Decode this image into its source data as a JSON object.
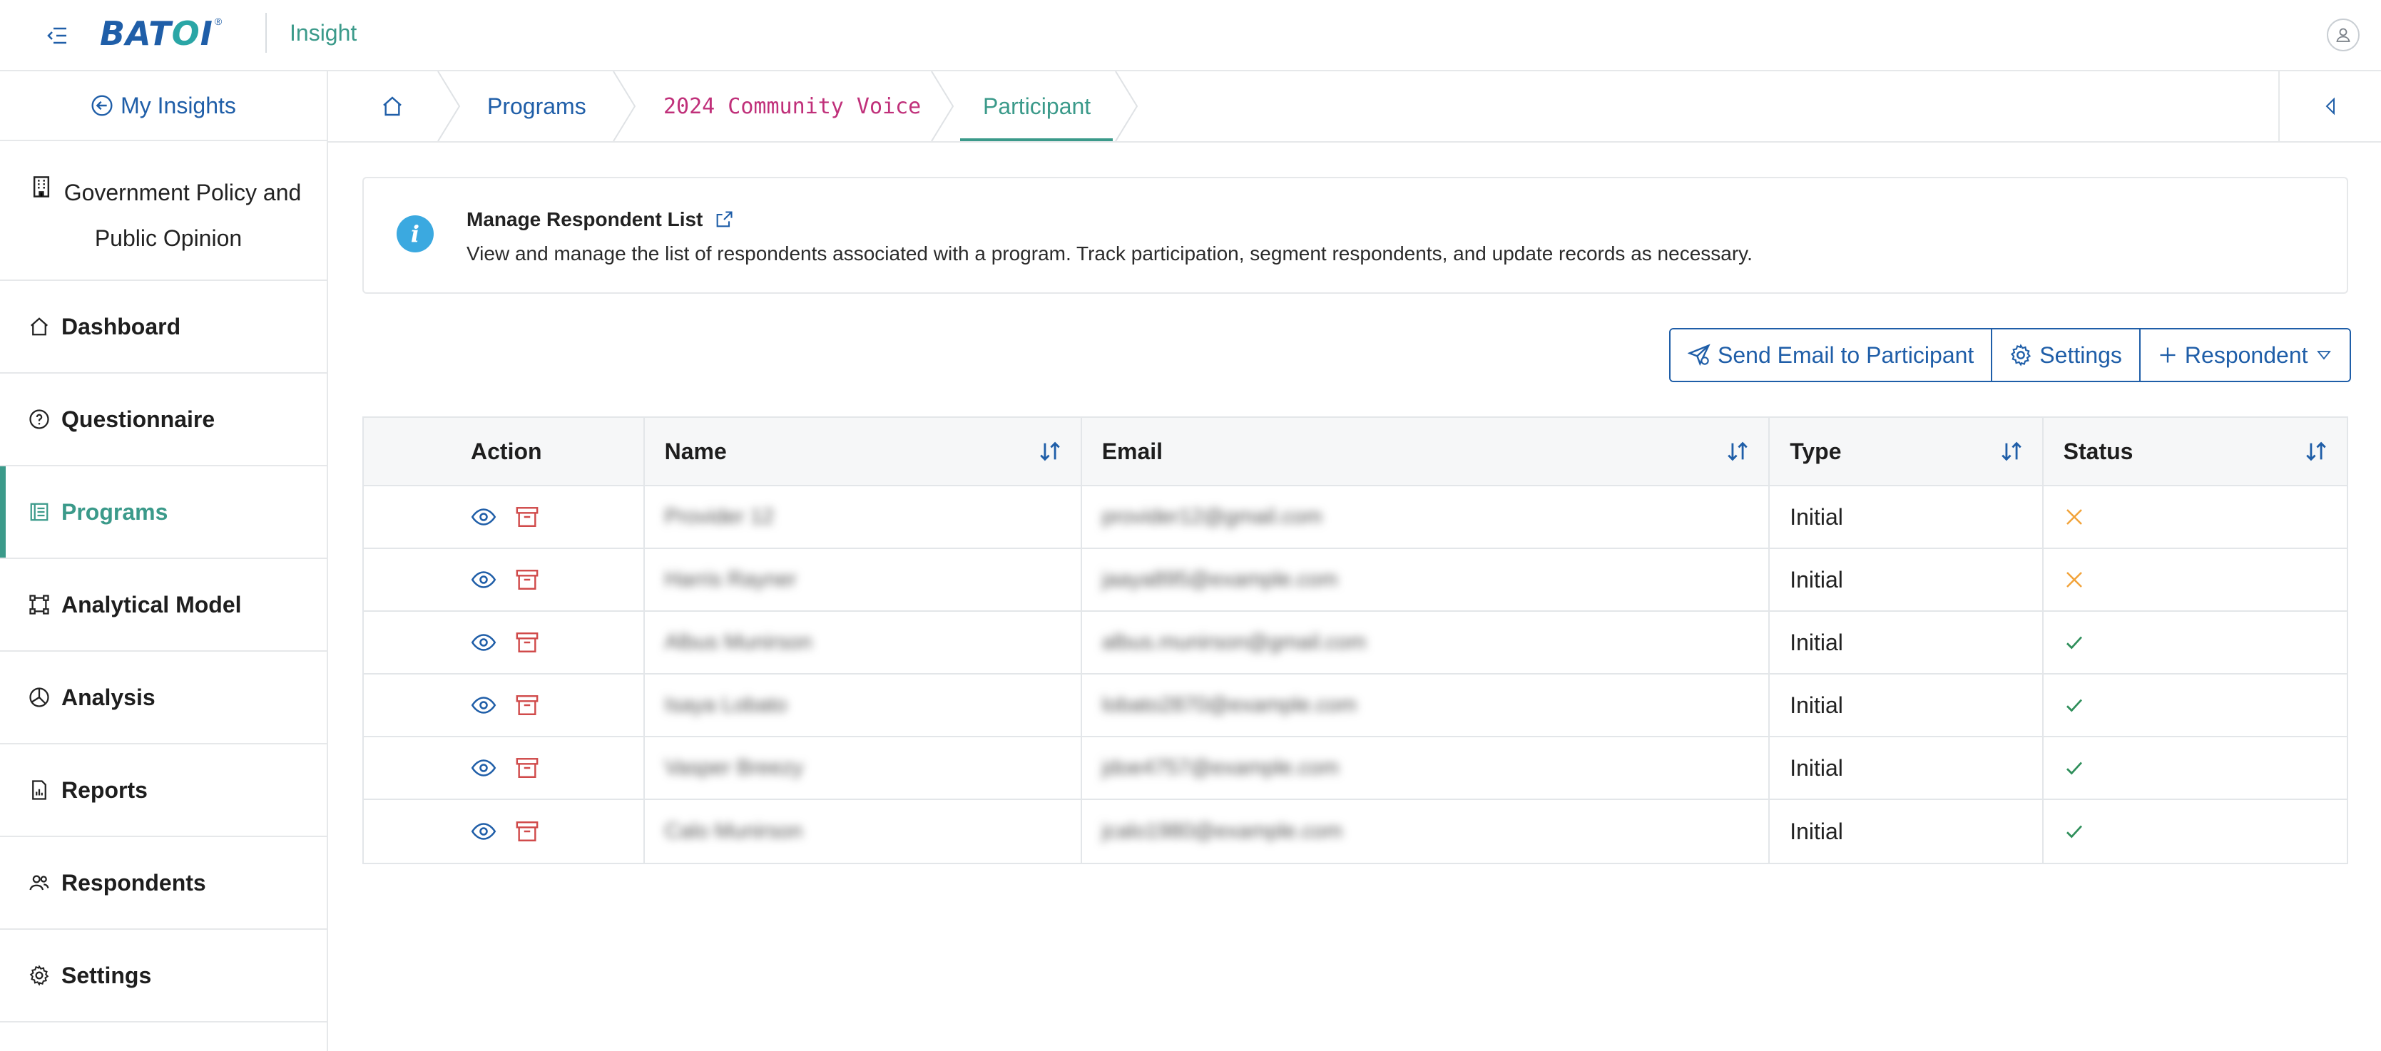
{
  "header": {
    "logo": "BATOI",
    "app_name": "Insight",
    "menu_icon": "menu-collapse-icon",
    "user_icon": "user-icon"
  },
  "sidebar": {
    "my_insights": "My Insights",
    "project_line1": "Government Policy and",
    "project_line2": "Public Opinion",
    "items": [
      {
        "label": "Dashboard",
        "icon": "home-icon"
      },
      {
        "label": "Questionnaire",
        "icon": "question-circle-icon"
      },
      {
        "label": "Programs",
        "icon": "programs-icon",
        "active": true
      },
      {
        "label": "Analytical Model",
        "icon": "model-icon"
      },
      {
        "label": "Analysis",
        "icon": "pie-chart-icon"
      },
      {
        "label": "Reports",
        "icon": "report-icon"
      },
      {
        "label": "Respondents",
        "icon": "users-icon"
      },
      {
        "label": "Settings",
        "icon": "gear-icon"
      }
    ]
  },
  "breadcrumb": {
    "home_icon": "home-icon",
    "programs": "Programs",
    "program": "2024 Community Voice",
    "current": "Participant"
  },
  "info": {
    "title": "Manage Respondent List",
    "description": "View and manage the list of respondents associated with a program. Track participation, segment respondents, and update records as necessary."
  },
  "toolbar": {
    "send_email": "Send Email to Participant",
    "settings": "Settings",
    "respondent": "Respondent"
  },
  "table": {
    "headers": {
      "action": "Action",
      "name": "Name",
      "email": "Email",
      "type": "Type",
      "status": "Status"
    },
    "rows": [
      {
        "name": "Provider 12",
        "email": "provider12@gmail.com",
        "type": "Initial",
        "status": "incomplete"
      },
      {
        "name": "Harris Rayner",
        "email": "jaaya895@example.com",
        "type": "Initial",
        "status": "incomplete"
      },
      {
        "name": "Albus Munirson",
        "email": "albus.munirson@gmail.com",
        "type": "Initial",
        "status": "complete"
      },
      {
        "name": "Isaya Lobato",
        "email": "lobato2870@example.com",
        "type": "Initial",
        "status": "complete"
      },
      {
        "name": "Vasper Breezy",
        "email": "jdoe4757@example.com",
        "type": "Initial",
        "status": "complete"
      },
      {
        "name": "Calo Munirson",
        "email": "jcalo1980@example.com",
        "type": "Initial",
        "status": "complete"
      }
    ]
  },
  "colors": {
    "primary": "#1f5ea8",
    "accent": "#3b9a8a",
    "danger": "#d04a4a",
    "warning": "#f2a33a",
    "success": "#2f8f5b"
  }
}
